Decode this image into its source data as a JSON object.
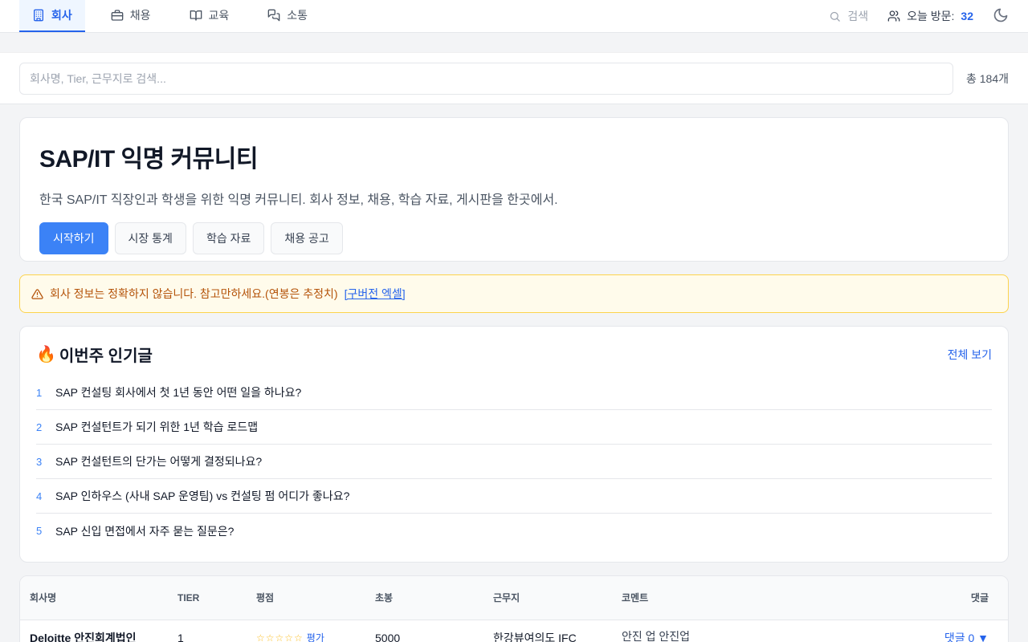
{
  "nav": {
    "tabs": [
      {
        "label": "회사",
        "icon": "building-icon"
      },
      {
        "label": "채용",
        "icon": "briefcase-icon"
      },
      {
        "label": "교육",
        "icon": "book-icon"
      },
      {
        "label": "소통",
        "icon": "chat-icon"
      }
    ],
    "search_label": "검색",
    "visits_label": "오늘 방문:",
    "visits_count": "32"
  },
  "search": {
    "placeholder": "회사명, Tier, 근무지로 검색...",
    "total": "총 184개"
  },
  "hero": {
    "title": "SAP/IT 익명 커뮤니티",
    "subtitle": "한국 SAP/IT 직장인과 학생을 위한 익명 커뮤니티. 회사 정보, 채용, 학습 자료, 게시판을 한곳에서.",
    "buttons": [
      "시작하기",
      "시장 통계",
      "학습 자료",
      "채용 공고"
    ]
  },
  "notice": {
    "text": "회사 정보는 정확하지 않습니다. 참고만하세요.(연봉은 추정치)",
    "link": "[구버전 엑셀]"
  },
  "popular": {
    "emoji": "🔥",
    "title": "이번주 인기글",
    "view_all": "전체 보기",
    "items": [
      {
        "rank": "1",
        "title": "SAP 컨설팅 회사에서 첫 1년 동안 어떤 일을 하나요?"
      },
      {
        "rank": "2",
        "title": "SAP 컨설턴트가 되기 위한 1년 학습 로드맵"
      },
      {
        "rank": "3",
        "title": "SAP 컨설턴트의 단가는 어떻게 결정되나요?"
      },
      {
        "rank": "4",
        "title": "SAP 인하우스 (사내 SAP 운영팀) vs 컨설팅 펌 어디가 좋나요?"
      },
      {
        "rank": "5",
        "title": "SAP 신입 면접에서 자주 묻는 질문은?"
      }
    ]
  },
  "table": {
    "headers": {
      "name": "회사명",
      "tier": "TIER",
      "rating": "평점",
      "salary": "초봉",
      "location": "근무지",
      "comment": "코멘트",
      "replies": "댓글"
    },
    "rows": [
      {
        "name": "Deloitte 안진회계법인",
        "tier": "1",
        "stars": "☆☆☆☆☆",
        "rate_label": "평가",
        "salary": "5000",
        "location": "한강뷰여의도 IFC",
        "comment": "안진 업 안진업",
        "replies": "댓글 0 ▼"
      }
    ]
  }
}
